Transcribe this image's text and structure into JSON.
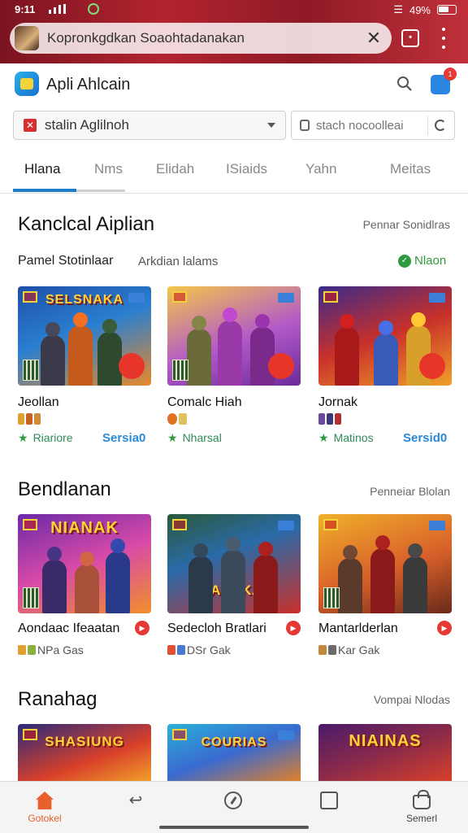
{
  "status_bar": {
    "time": "9:11",
    "battery": "49%"
  },
  "browser": {
    "url": "Kopronkgdkan Soaohtadanakan",
    "close_icon": "close-icon",
    "tabs_icon": "tab-switcher-icon",
    "menu_icon": "more-vert-icon"
  },
  "app": {
    "title": "Apli Ahlcain",
    "cart_badge": "1",
    "accent": "#1e7dc8"
  },
  "filter": {
    "select_value": "stalin Aglilnoh",
    "search_placeholder": "stach nocoolleai"
  },
  "tabs": [
    {
      "label": "Hlana"
    },
    {
      "label": "Nms"
    },
    {
      "label": "Elidah"
    },
    {
      "label": "ISiaids"
    },
    {
      "label": "Yahn"
    },
    {
      "label": "Meitas"
    }
  ],
  "section1": {
    "title": "Kanclcal Aiplian",
    "link": "Pennar Sonidlras",
    "subhead": "Pamel Stotinlaar",
    "subhead2": "Arkdian lalams",
    "green_link": "Nlaon",
    "cards": [
      {
        "name": "Jeollan",
        "tag": "Riariore",
        "price": "Sersia0",
        "banner": "SELSNAKA"
      },
      {
        "name": "Comalc Hiah",
        "tag": "Nharsal",
        "price": "",
        "banner": ""
      },
      {
        "name": "Jornak",
        "tag": "Matinos",
        "price": "Sersid0",
        "banner": ""
      }
    ]
  },
  "section2": {
    "title": "Bendlanan",
    "link": "Penneiar Blolan",
    "cards": [
      {
        "name": "Aondaac Ifeaatan",
        "meta": "NPa Gas",
        "banner": "NIANAK"
      },
      {
        "name": "Sedecloh Bratlari",
        "meta": "DSr Gak",
        "banner": "NIALAKAS"
      },
      {
        "name": "Mantarlderlan",
        "meta": "Kar Gak",
        "banner": ""
      }
    ]
  },
  "section3": {
    "title": "Ranahag",
    "link": "Vompai Nlodas",
    "cards": [
      {
        "banner": "SHASIUNG"
      },
      {
        "banner": "COURIAS"
      },
      {
        "banner": "NIAINAS"
      }
    ]
  },
  "bottom_nav": [
    {
      "label": "Gotokel",
      "icon": "home-icon"
    },
    {
      "label": "",
      "icon": "swipe-icon"
    },
    {
      "label": "",
      "icon": "compass-icon"
    },
    {
      "label": "",
      "icon": "document-icon"
    },
    {
      "label": "Semerl",
      "icon": "shopping-bag-icon"
    }
  ]
}
